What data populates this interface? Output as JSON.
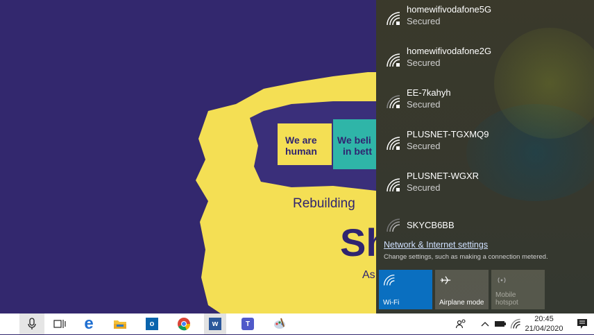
{
  "wallpaper": {
    "we_are_line1": "We are",
    "we_are_line2": "human",
    "we_believe_line1": "We beli",
    "we_believe_line2": "in bett",
    "rebuilding": "Rebuilding",
    "big_letters": "Sh",
    "as_text": "As",
    "colors": {
      "background": "#33286e",
      "yellow": "#f4df54",
      "teal": "#2fb5a8"
    }
  },
  "network_flyout": {
    "networks": [
      {
        "name": "homewifivodafone5G",
        "status": "Secured"
      },
      {
        "name": "homewifivodafone2G",
        "status": "Secured"
      },
      {
        "name": "EE-7kahyh",
        "status": "Secured"
      },
      {
        "name": "PLUSNET-TGXMQ9",
        "status": "Secured"
      },
      {
        "name": "PLUSNET-WGXR",
        "status": "Secured"
      },
      {
        "name": "SKYCB6BB",
        "status": ""
      }
    ],
    "settings_link": "Network & Internet settings",
    "settings_desc": "Change settings, such as making a connection metered.",
    "tiles": [
      {
        "label": "Wi-Fi",
        "icon": "wifi-icon",
        "active": true
      },
      {
        "label": "Airplane mode",
        "icon": "airplane-icon",
        "active": false
      },
      {
        "label_line1": "Mobile",
        "label_line2": "hotspot",
        "icon": "hotspot-icon",
        "active": false,
        "disabled": true
      }
    ],
    "colors": {
      "accent": "#0078d7"
    }
  },
  "taskbar": {
    "icons": [
      "microphone-icon",
      "task-view-icon",
      "edge-icon",
      "file-explorer-icon",
      "outlook-icon",
      "chrome-icon",
      "word-icon",
      "teams-icon",
      "paint-icon"
    ],
    "tray_icons": [
      "people-icon",
      "chevron-up-icon",
      "battery-icon",
      "wifi-icon",
      "action-center-icon"
    ],
    "time": "20:45",
    "date": "21/04/2020"
  }
}
